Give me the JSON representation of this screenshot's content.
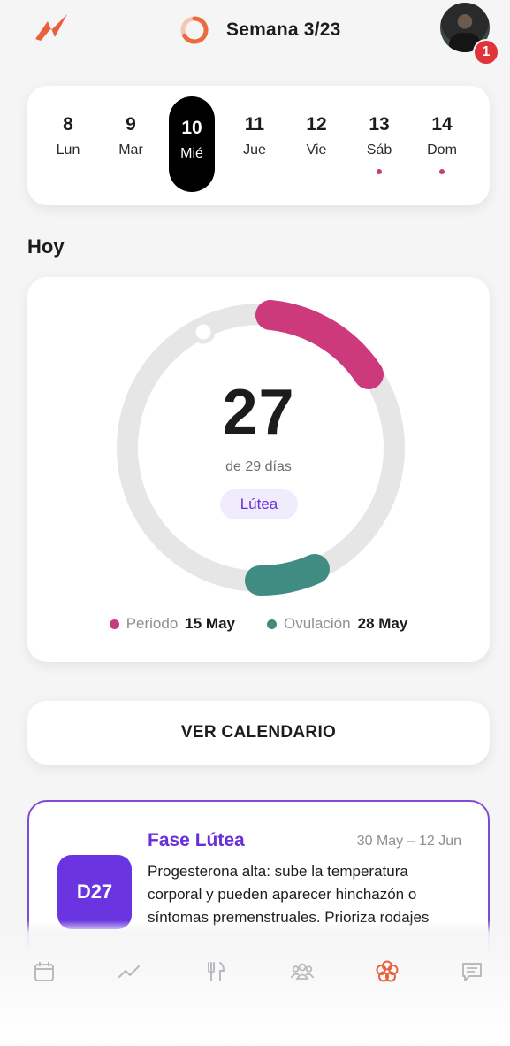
{
  "header": {
    "week_label": "Semana 3/23"
  },
  "notifications": {
    "count": "1"
  },
  "week": {
    "days": [
      {
        "num": "8",
        "name": "Lun",
        "selected": false,
        "dot": false
      },
      {
        "num": "9",
        "name": "Mar",
        "selected": false,
        "dot": false
      },
      {
        "num": "10",
        "name": "Mié",
        "selected": true,
        "dot": false
      },
      {
        "num": "11",
        "name": "Jue",
        "selected": false,
        "dot": false
      },
      {
        "num": "12",
        "name": "Vie",
        "selected": false,
        "dot": false
      },
      {
        "num": "13",
        "name": "Sáb",
        "selected": false,
        "dot": true
      },
      {
        "num": "14",
        "name": "Dom",
        "selected": false,
        "dot": true
      }
    ]
  },
  "today": {
    "title": "Hoy",
    "cycle_day": "27",
    "cycle_length_text": "de 29 días",
    "phase": "Lútea",
    "legend": [
      {
        "key": "Periodo",
        "value": "15 May",
        "color": "#c93b7a"
      },
      {
        "key": "Ovulación",
        "value": "28 May",
        "color": "#3e8c82"
      }
    ]
  },
  "calendar_button": {
    "label": "VER CALENDARIO"
  },
  "phase_card": {
    "badge": "D27",
    "title": "Fase Lútea",
    "dates": "30 May – 12 Jun",
    "body": "Progesterona alta: sube la temperatura corporal y pueden aparecer hinchazón o síntomas premenstruales. Prioriza rodajes"
  },
  "nav": {
    "items": [
      "calendar-icon",
      "trend-icon",
      "fork-knife-icon",
      "people-icon",
      "flower-icon",
      "chat-icon"
    ],
    "active": "flower-icon",
    "active_color": "#e8603c",
    "inactive_color": "#b9b9be"
  },
  "colors": {
    "accent_period": "#c93b7a",
    "accent_ovulation": "#3e8c82",
    "accent_phase": "#6a2fd6",
    "logo": "#e8603c"
  }
}
